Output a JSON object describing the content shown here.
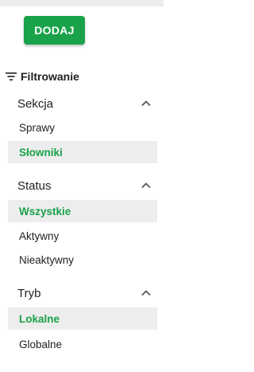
{
  "toolbar": {
    "add_label": "DODAJ"
  },
  "filters": {
    "title": "Filtrowanie",
    "icon": "filter-list-icon",
    "sections": [
      {
        "title": "Sekcja",
        "expanded": true,
        "items": [
          {
            "label": "Sprawy",
            "selected": false
          },
          {
            "label": "Słowniki",
            "selected": true
          }
        ]
      },
      {
        "title": "Status",
        "expanded": true,
        "items": [
          {
            "label": "Wszystkie",
            "selected": true
          },
          {
            "label": "Aktywny",
            "selected": false
          },
          {
            "label": "Nieaktywny",
            "selected": false
          }
        ]
      },
      {
        "title": "Tryb",
        "expanded": true,
        "items": [
          {
            "label": "Lokalne",
            "selected": true
          },
          {
            "label": "Globalne",
            "selected": false
          }
        ]
      }
    ]
  },
  "colors": {
    "accent": "#1aa24a",
    "selected_bg": "#ededed",
    "text": "#212121"
  }
}
